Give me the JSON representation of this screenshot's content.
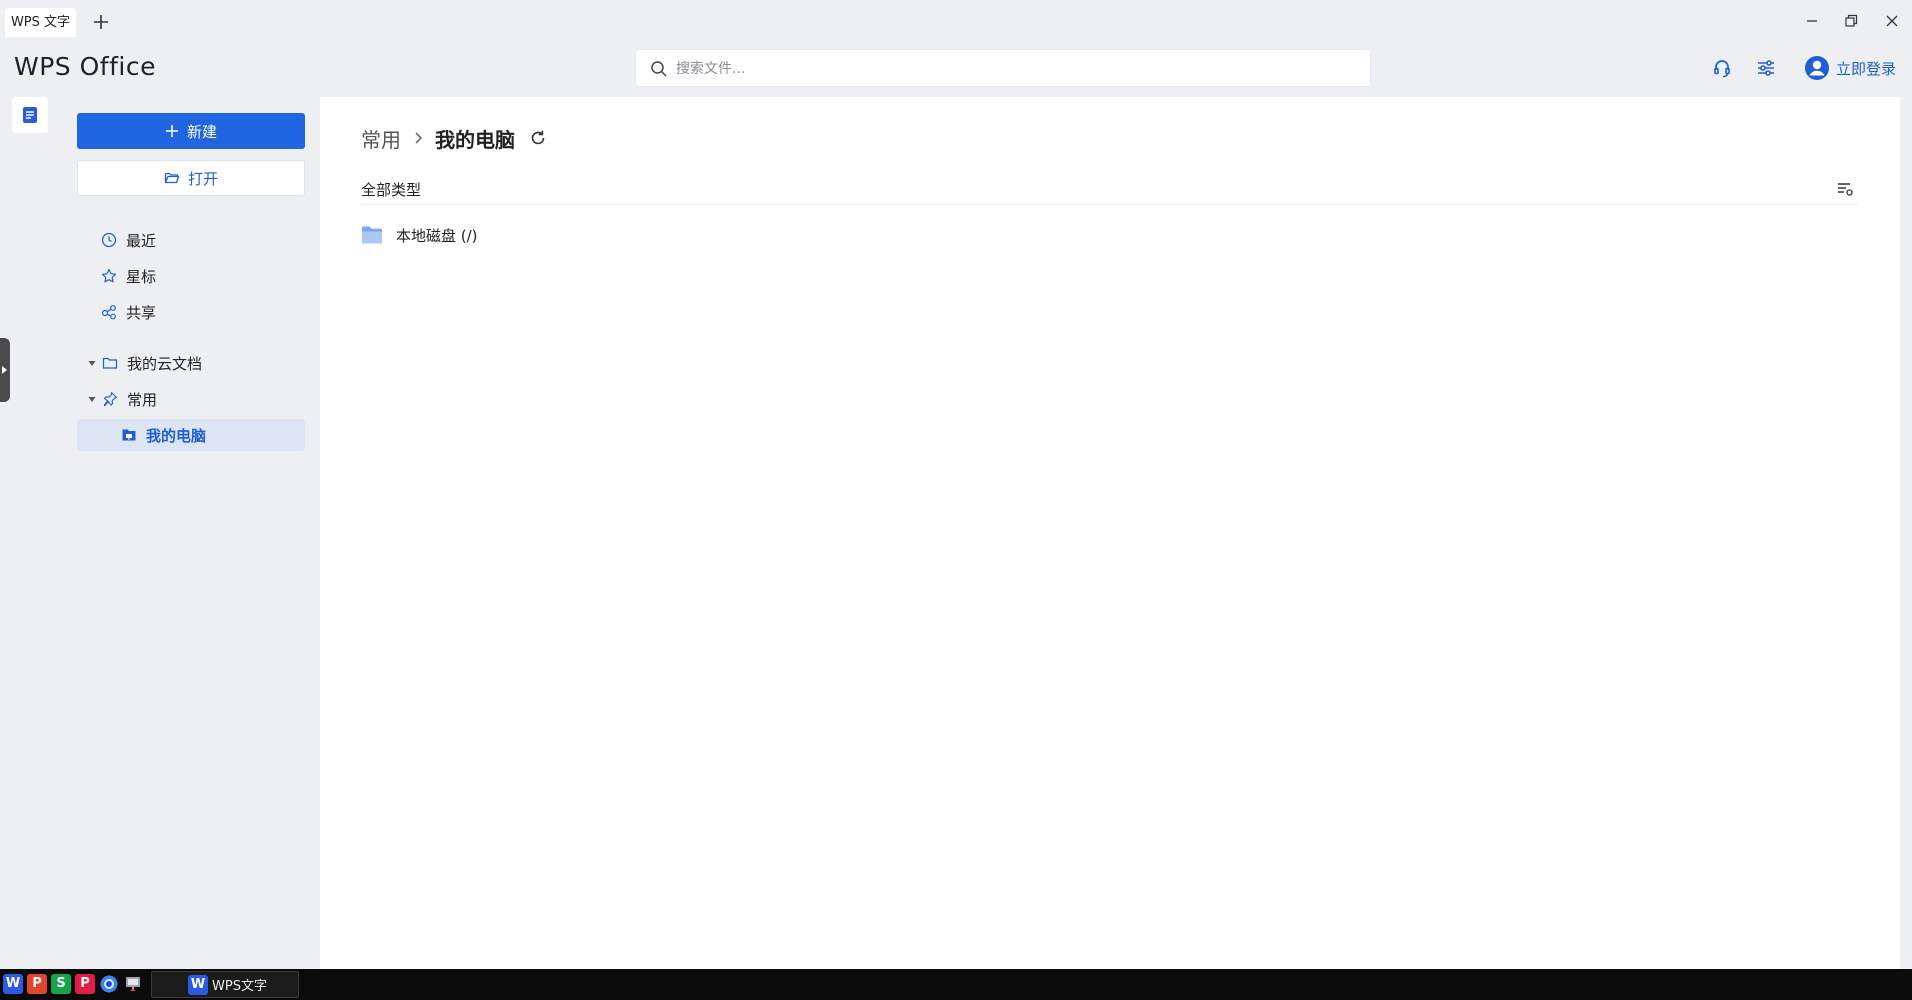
{
  "tabs": {
    "active_label": "WPS 文字"
  },
  "header": {
    "logo_text": "WPS Office",
    "search_placeholder": "搜索文件...",
    "login_label": "立即登录"
  },
  "sidebar": {
    "new_label": "新建",
    "open_label": "打开",
    "nav_items": [
      {
        "label": "最近",
        "icon": "clock-icon"
      },
      {
        "label": "星标",
        "icon": "star-icon"
      },
      {
        "label": "共享",
        "icon": "share-icon"
      }
    ],
    "tree_items": [
      {
        "label": "我的云文档",
        "icon": "folder-icon",
        "expanded": true
      },
      {
        "label": "常用",
        "icon": "pin-icon",
        "expanded": true
      },
      {
        "label": "我的电脑",
        "icon": "computer-folder-icon",
        "selected": true
      }
    ]
  },
  "main": {
    "breadcrumb": {
      "parent": "常用",
      "current": "我的电脑"
    },
    "filter_label": "全部类型",
    "files": [
      {
        "name": "本地磁盘 (/)",
        "icon": "folder-icon"
      }
    ]
  },
  "taskbar": {
    "apps": [
      {
        "letter": "W",
        "color": "#2b5ae6"
      },
      {
        "letter": "P",
        "color": "#e2462a"
      },
      {
        "letter": "S",
        "color": "#16a34a"
      },
      {
        "letter": "P",
        "color": "#e11d48"
      }
    ],
    "window_label": "WPS文字",
    "window_app_letter": "W"
  },
  "colors": {
    "accent": "#1f66e0",
    "accent_text": "#1f5fd6",
    "selected_bg": "#dde5f4",
    "chrome_bg": "#eeeff2"
  }
}
